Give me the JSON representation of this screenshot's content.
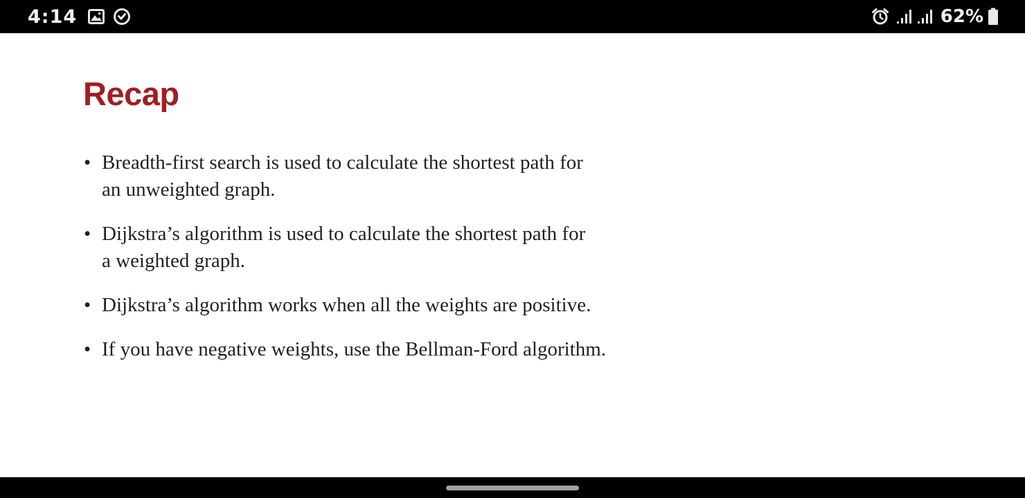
{
  "status_bar": {
    "time": "4:14",
    "battery_percent": "62%",
    "left_icons": [
      "gallery-icon",
      "sync-icon"
    ],
    "right_icons": [
      "alarm-icon",
      "signal-icon",
      "signal-icon",
      "battery-icon"
    ]
  },
  "page": {
    "title": "Recap",
    "title_color": "#a01e23",
    "bullet_symbol": "•",
    "bullets": [
      {
        "line1": "Breadth-first search is used to calculate the shortest path for",
        "line2": "an unweighted graph."
      },
      {
        "line1": "Dijkstra’s algorithm is used to calculate the shortest path for",
        "line2": "a weighted graph."
      },
      {
        "line1": "Dijkstra’s algorithm works when all the weights are positive.",
        "line2": ""
      },
      {
        "line1": "If you have negative weights, use the Bellman-Ford algorithm.",
        "line2": ""
      }
    ]
  }
}
